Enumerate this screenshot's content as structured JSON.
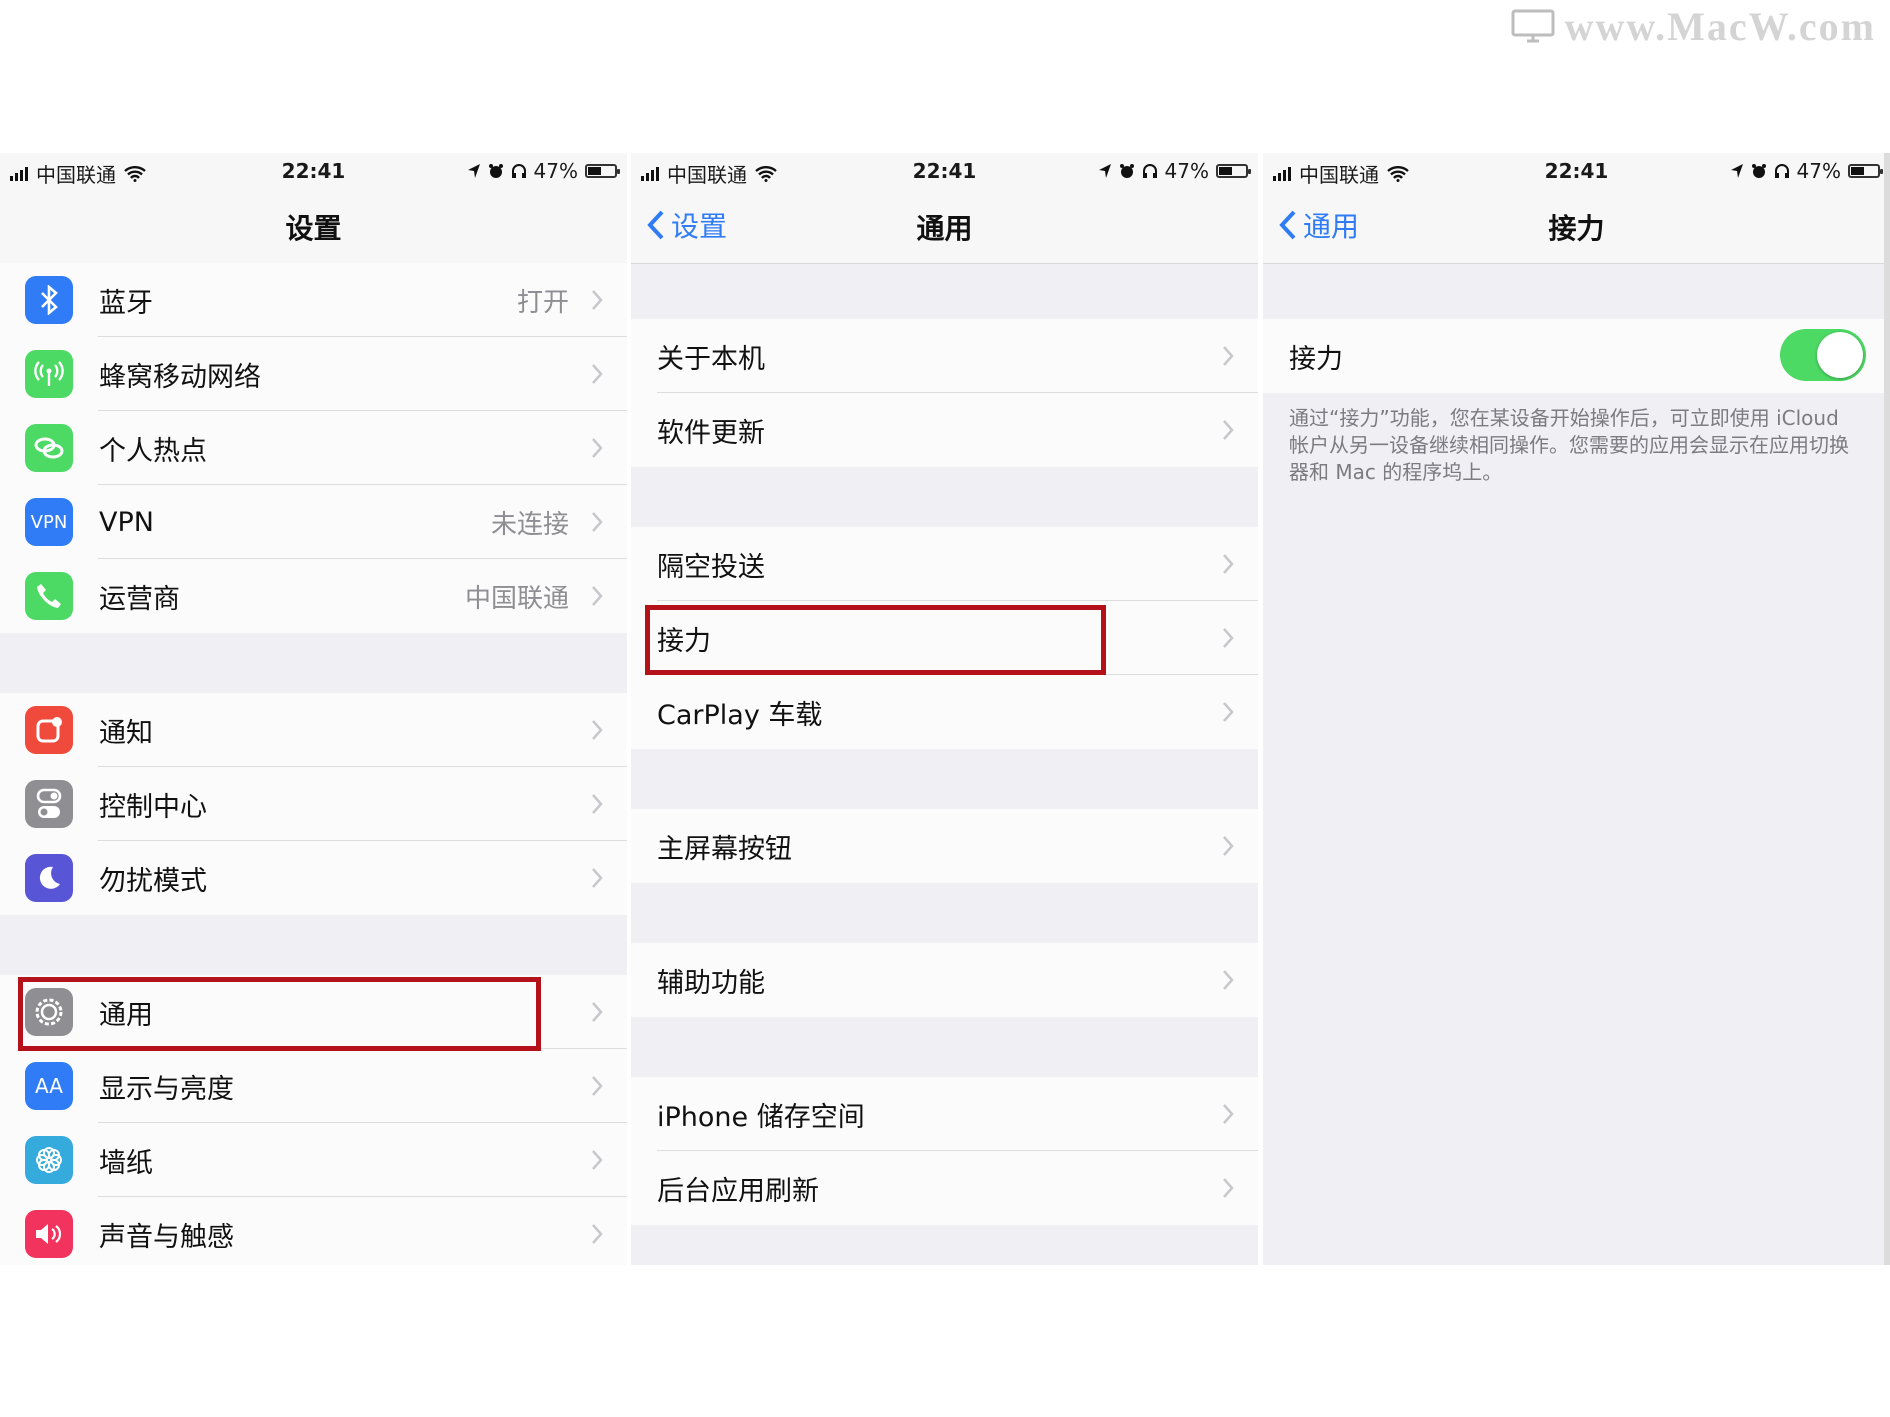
{
  "watermark": "www.MacW.com",
  "status": {
    "carrier": "中国联通",
    "time": "22:41",
    "battery": "47%"
  },
  "panel1": {
    "title": "设置",
    "groups": [
      [
        {
          "label": "蓝牙",
          "value": "打开",
          "icon": "bluetooth-icon",
          "color": "#2f7cf6"
        },
        {
          "label": "蜂窝移动网络",
          "value": "",
          "icon": "antenna-icon",
          "color": "#4cd964"
        },
        {
          "label": "个人热点",
          "value": "",
          "icon": "link-icon",
          "color": "#4cd964"
        },
        {
          "label": "VPN",
          "value": "未连接",
          "icon": "vpn-icon",
          "color": "#2f7cf6"
        },
        {
          "label": "运营商",
          "value": "中国联通",
          "icon": "phone-icon",
          "color": "#4cd964"
        }
      ],
      [
        {
          "label": "通知",
          "value": "",
          "icon": "notification-icon",
          "color": "#f04a3c"
        },
        {
          "label": "控制中心",
          "value": "",
          "icon": "switches-icon",
          "color": "#8e8e93"
        },
        {
          "label": "勿扰模式",
          "value": "",
          "icon": "moon-icon",
          "color": "#5856d6"
        }
      ],
      [
        {
          "label": "通用",
          "value": "",
          "icon": "gear-icon",
          "color": "#8e8e93"
        },
        {
          "label": "显示与亮度",
          "value": "",
          "icon": "text-size-icon",
          "color": "#2f7cf6"
        },
        {
          "label": "墙纸",
          "value": "",
          "icon": "flower-icon",
          "color": "#35aadc"
        },
        {
          "label": "声音与触感",
          "value": "",
          "icon": "speaker-icon",
          "color": "#f2335d"
        }
      ]
    ],
    "vpn_badge": "VPN",
    "text_size_badge": "AA"
  },
  "panel2": {
    "back": "设置",
    "title": "通用",
    "groups": [
      [
        "关于本机",
        "软件更新"
      ],
      [
        "隔空投送",
        "接力",
        "CarPlay 车载"
      ],
      [
        "主屏幕按钮"
      ],
      [
        "辅助功能"
      ],
      [
        "iPhone 储存空间",
        "后台应用刷新"
      ]
    ]
  },
  "panel3": {
    "back": "通用",
    "title": "接力",
    "toggle_label": "接力",
    "toggle_on": true,
    "footnote": "通过“接力”功能，您在某设备开始操作后，可立即使用 iCloud 帐户从另一设备继续相同操作。您需要的应用会显示在应用切换器和 Mac 的程序坞上。"
  }
}
